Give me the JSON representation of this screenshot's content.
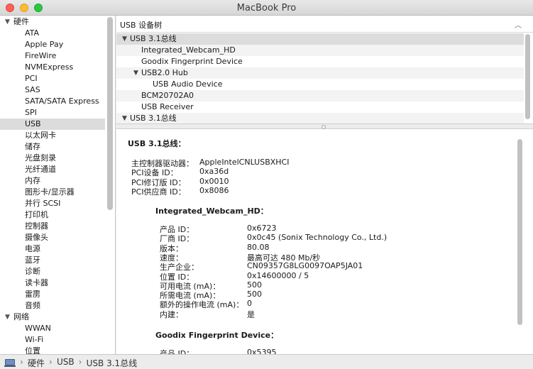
{
  "window": {
    "title": "MacBook Pro"
  },
  "sidebar": {
    "categories": [
      {
        "label": "硬件",
        "items": [
          "ATA",
          "Apple Pay",
          "FireWire",
          "NVMExpress",
          "PCI",
          "SAS",
          "SATA/SATA Express",
          "SPI",
          "USB",
          "以太网卡",
          "储存",
          "光盘刻录",
          "光纤通道",
          "内存",
          "图形卡/显示器",
          "并行 SCSI",
          "打印机",
          "控制器",
          "摄像头",
          "电源",
          "蓝牙",
          "诊断",
          "读卡器",
          "雷雳",
          "音频"
        ]
      },
      {
        "label": "网络",
        "items": [
          "WWAN",
          "Wi-Fi",
          "位置"
        ]
      }
    ],
    "selected": "USB"
  },
  "tree": {
    "header": "USB 设备树",
    "rows": [
      {
        "label": "USB 3.1总线",
        "level": 0,
        "expanded": true
      },
      {
        "label": "Integrated_Webcam_HD",
        "level": 1
      },
      {
        "label": "Goodix Fingerprint Device",
        "level": 1
      },
      {
        "label": "USB2.0 Hub",
        "level": 1,
        "expanded": true
      },
      {
        "label": "USB Audio Device",
        "level": 2
      },
      {
        "label": "BCM20702A0",
        "level": 1
      },
      {
        "label": "USB Receiver",
        "level": 1
      },
      {
        "label": "USB 3.1总线",
        "level": 0,
        "expanded": true
      }
    ]
  },
  "detail": {
    "title": "USB 3.1总线：",
    "bus_props": [
      {
        "label": "主控制器驱动器：",
        "value": "AppleIntelCNLUSBXHCI"
      },
      {
        "label": "PCI设备 ID：",
        "value": "0xa36d"
      },
      {
        "label": "PCI修订版 ID：",
        "value": "0x0010"
      },
      {
        "label": "PCI供应商 ID：",
        "value": "0x8086"
      }
    ],
    "devices": [
      {
        "title": "Integrated_Webcam_HD：",
        "props": [
          {
            "label": "产品 ID：",
            "value": "0x6723"
          },
          {
            "label": "厂商 ID：",
            "value": "0x0c45  (Sonix Technology Co., Ltd.)"
          },
          {
            "label": "版本：",
            "value": "80.08"
          },
          {
            "label": "速度：",
            "value": "最高可达 480 Mb/秒"
          },
          {
            "label": "生产企业：",
            "value": "CN09357G8LG0097OAP5JA01"
          },
          {
            "label": "位置 ID：",
            "value": "0x14600000 / 5"
          },
          {
            "label": "可用电流 (mA)：",
            "value": "500"
          },
          {
            "label": "所需电流 (mA)：",
            "value": "500"
          },
          {
            "label": "额外的操作电流 (mA)：",
            "value": "0"
          },
          {
            "label": "内建：",
            "value": "是"
          }
        ]
      },
      {
        "title": "Goodix Fingerprint Device：",
        "props": [
          {
            "label": "产品 ID：",
            "value": "0x5395"
          }
        ]
      }
    ]
  },
  "statusbar": {
    "breadcrumb": [
      "硬件",
      "USB",
      "USB 3.1总线"
    ],
    "separator": "›"
  }
}
